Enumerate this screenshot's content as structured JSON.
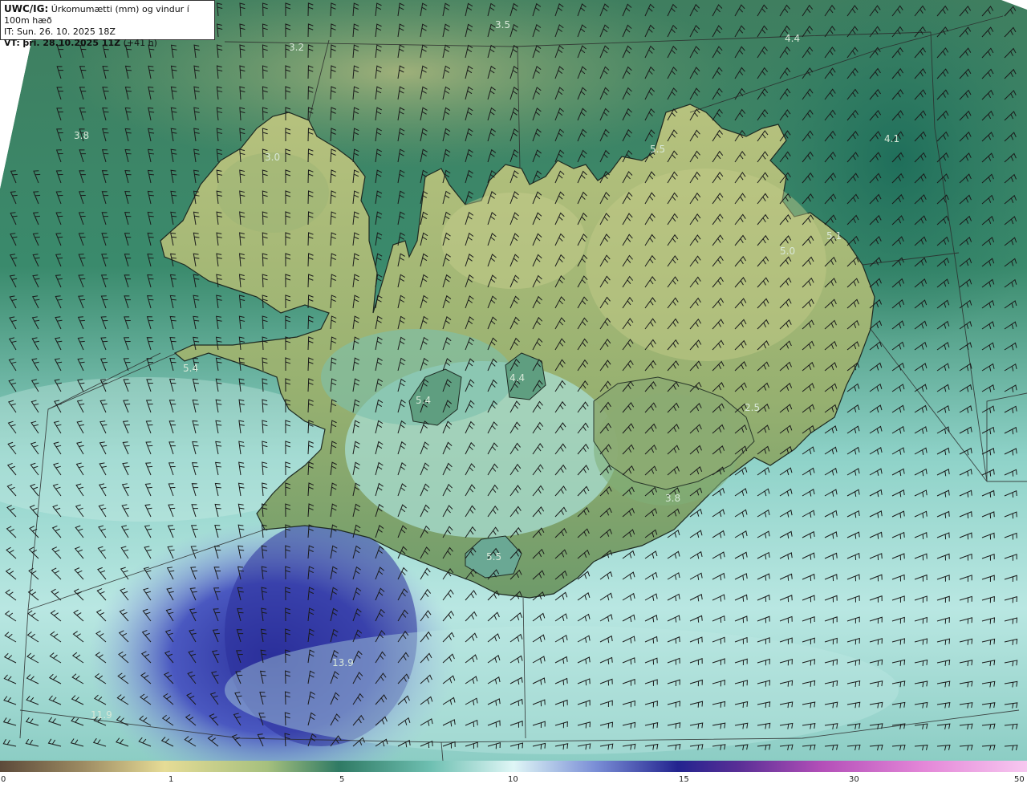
{
  "header": {
    "line1_tag": "UWC/IG:",
    "line1_text": "Úrkomumætti (mm) og vindur í 100m hæð",
    "line2_tag": "IT:",
    "line2_text": "Sun. 26. 10. 2025 18Z",
    "line3_tag": "VT:",
    "line3_strong": "þri. 28.10.2025 11Z",
    "line3_text": "(+41 h)"
  },
  "map_labels": [
    {
      "text": "3.5"
    },
    {
      "text": "4.4"
    },
    {
      "text": "3.2"
    },
    {
      "text": "3.8"
    },
    {
      "text": "3.0"
    },
    {
      "text": "5.5"
    },
    {
      "text": "4.1"
    },
    {
      "text": "5.1"
    },
    {
      "text": "5.0"
    },
    {
      "text": "5.4"
    },
    {
      "text": "4.4"
    },
    {
      "text": "5.4"
    },
    {
      "text": "2.5"
    },
    {
      "text": "3.8"
    },
    {
      "text": "5.5"
    },
    {
      "text": "13.9"
    },
    {
      "text": "11.9"
    }
  ],
  "colorbar": {
    "ticks": [
      "0",
      "1",
      "5",
      "10",
      "15",
      "30",
      "50"
    ],
    "colors": [
      "#5c4a3a",
      "#b8a878",
      "#e8de98",
      "#6fa070",
      "#2f7a64",
      "#9ed8d0",
      "#dff6f6",
      "#6f7fd0",
      "#23248f",
      "#7a3aa0",
      "#d460c8",
      "#f3b4ea"
    ]
  },
  "palette": {
    "sea_far": "#2c6f62",
    "sea_mid": "#4e9c86",
    "sea_light": "#bfe9e4",
    "heavy": "#2e36a2",
    "land_low": "#8aa86a",
    "land_high": "#c6cc8a"
  }
}
